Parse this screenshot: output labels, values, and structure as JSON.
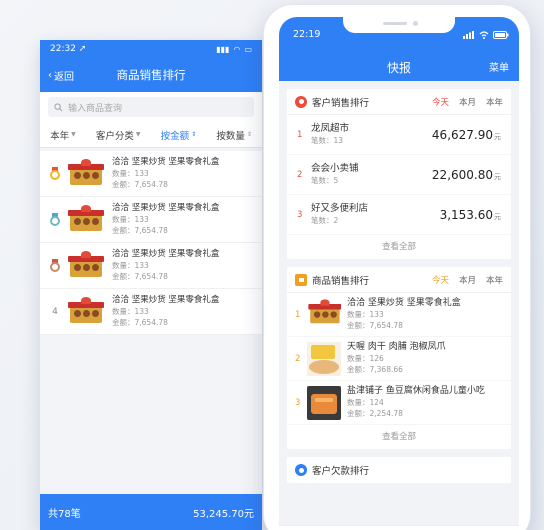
{
  "left": {
    "status_time": "22:32",
    "nav_back": "返回",
    "nav_title": "商品销售排行",
    "search_placeholder": "输入商品查询",
    "filters": [
      {
        "label": "本年",
        "active": false
      },
      {
        "label": "客户分类",
        "active": false
      },
      {
        "label": "按金额",
        "active": true
      },
      {
        "label": "按数量",
        "active": false
      }
    ],
    "items": [
      {
        "rank": "1",
        "name": "洽洽 坚果炒货 坚果零食礼盒",
        "qty": "数量：133",
        "amount": "金额：7,654.78"
      },
      {
        "rank": "2",
        "name": "洽洽 坚果炒货 坚果零食礼盒",
        "qty": "数量：133",
        "amount": "金额：7,654.78"
      },
      {
        "rank": "3",
        "name": "洽洽 坚果炒货 坚果零食礼盒",
        "qty": "数量：133",
        "amount": "金额：7,654.78"
      },
      {
        "rank": "4",
        "name": "洽洽 坚果炒货 坚果零食礼盒",
        "qty": "数量：133",
        "amount": "金额：7,654.78"
      }
    ],
    "footer_count": "共78笔",
    "footer_total": "53,245.70元"
  },
  "right": {
    "status_time": "22:19",
    "title": "快报",
    "menu": "菜单",
    "customer_card": {
      "title": "客户销售排行",
      "tabs": [
        "今天",
        "本月",
        "本年"
      ],
      "rows": [
        {
          "no": "1",
          "name": "龙凤超市",
          "count": "笔数：13",
          "amount": "46,627.90",
          "unit": "元"
        },
        {
          "no": "2",
          "name": "会会小卖铺",
          "count": "笔数：5",
          "amount": "22,600.80",
          "unit": "元"
        },
        {
          "no": "3",
          "name": "好又多便利店",
          "count": "笔数：2",
          "amount": "3,153.60",
          "unit": "元"
        }
      ],
      "more": "查看全部"
    },
    "product_card": {
      "title": "商品销售排行",
      "tabs": [
        "今天",
        "本月",
        "本年"
      ],
      "rows": [
        {
          "no": "1",
          "name": "洽洽 坚果炒货 坚果零食礼盒",
          "qty": "数量：133",
          "amount": "金额：7,654.78"
        },
        {
          "no": "2",
          "name": "天喔 肉干 肉脯 泡椒凤爪",
          "qty": "数量：126",
          "amount": "金额：7,368.66"
        },
        {
          "no": "3",
          "name": "盐津铺子 鱼豆腐休闲食品儿童小吃",
          "qty": "数量：124",
          "amount": "金额：2,254.78"
        }
      ],
      "more": "查看全部"
    },
    "debt_card": {
      "title": "客户欠款排行"
    }
  },
  "colors": {
    "primary": "#2f7ff5",
    "red": "#f04a3a",
    "orange": "#f0a020"
  }
}
